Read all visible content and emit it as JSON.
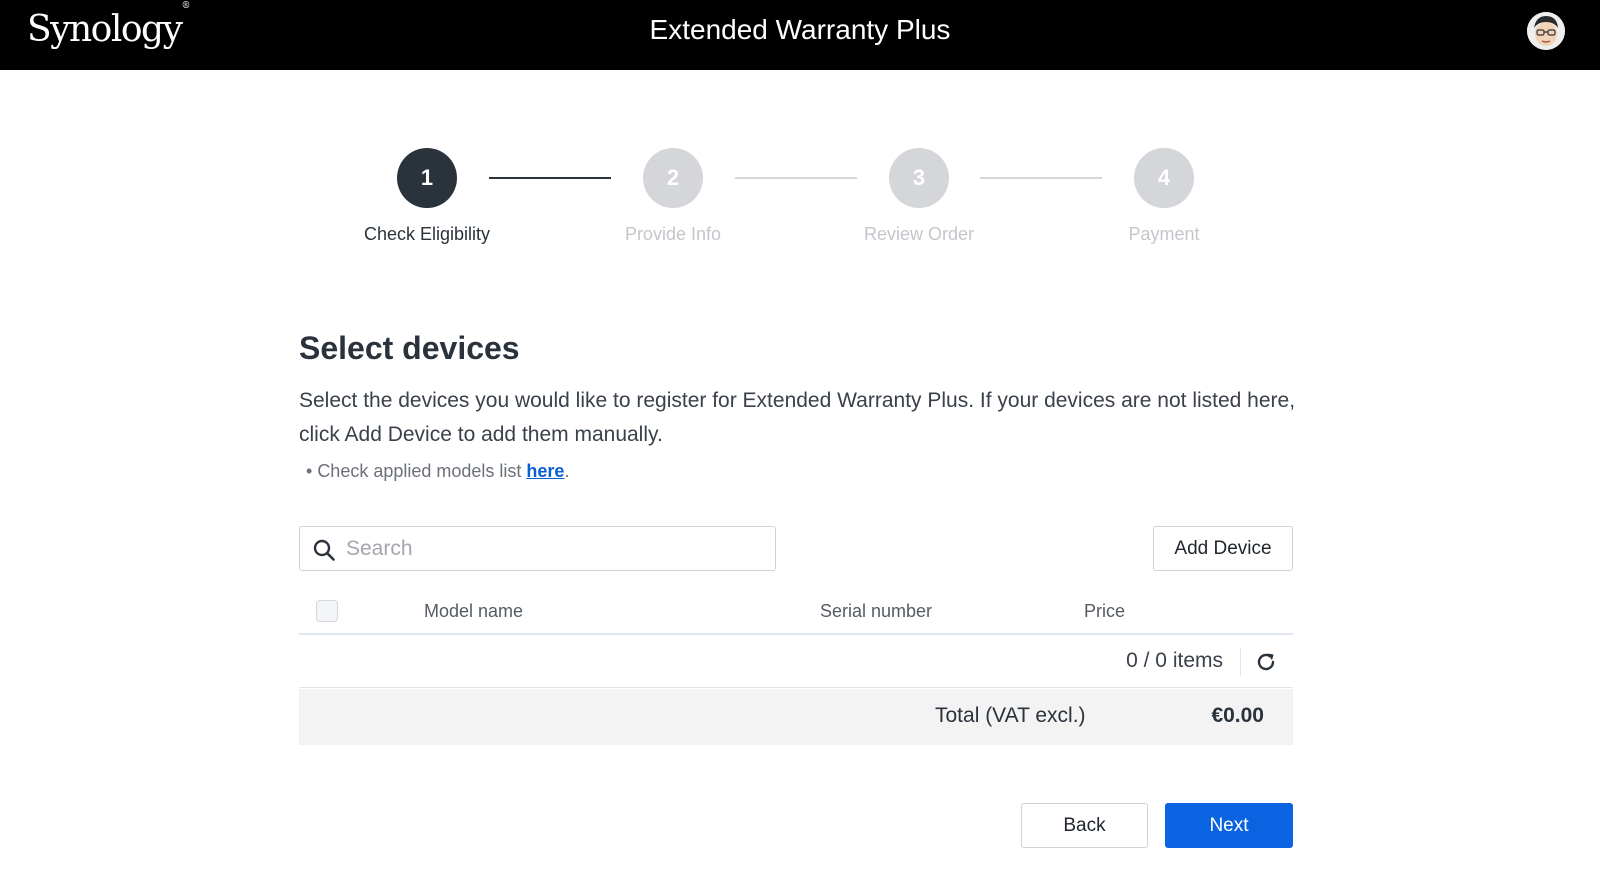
{
  "header": {
    "logo": "Synology",
    "logo_mark": "®",
    "title": "Extended Warranty Plus"
  },
  "stepper": {
    "current_step": 1,
    "steps": [
      {
        "number": "1",
        "label": "Check Eligibility"
      },
      {
        "number": "2",
        "label": "Provide Info"
      },
      {
        "number": "3",
        "label": "Review Order"
      },
      {
        "number": "4",
        "label": "Payment"
      }
    ]
  },
  "main": {
    "heading": "Select devices",
    "description": "Select the devices you would like to register for Extended Warranty Plus. If your devices are not listed here, click Add Device to add them manually.",
    "bullet_text": "Check applied models list ",
    "bullet_link": "here",
    "bullet_suffix": ".",
    "search_placeholder": "Search",
    "search_value": "",
    "add_device_label": "Add Device"
  },
  "table": {
    "columns": [
      "Model name",
      "Serial number",
      "Price"
    ],
    "rows": [],
    "pager_text": "0 / 0 items"
  },
  "total": {
    "label": "Total (VAT excl.)",
    "value": "€0.00"
  },
  "footer": {
    "back_label": "Back",
    "next_label": "Next"
  },
  "colors": {
    "accent": "#0a63e0",
    "step_active": "#2a323c",
    "step_inactive": "#d4d6d9"
  }
}
